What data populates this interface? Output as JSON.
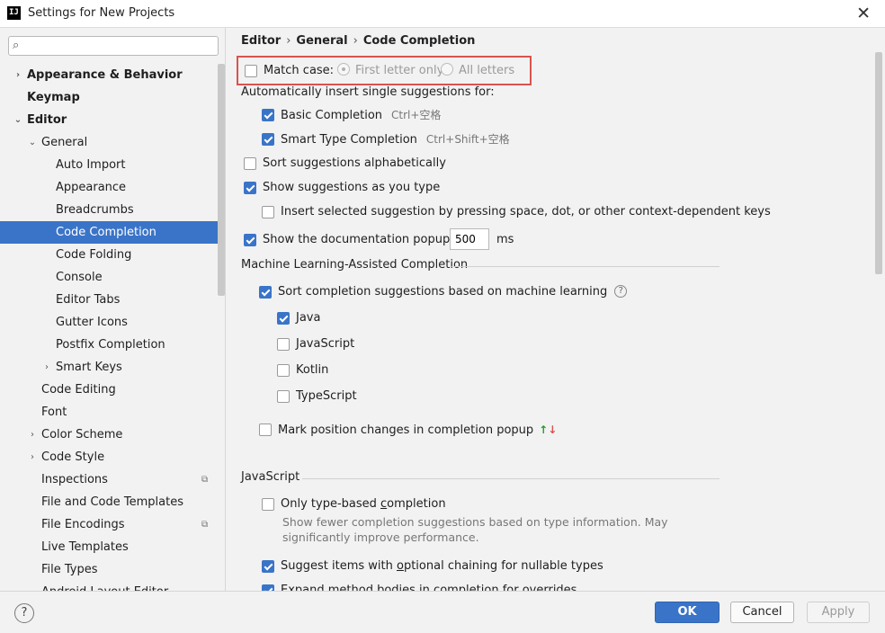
{
  "window": {
    "title": "Settings for New Projects",
    "app_icon_text": "IJ",
    "close_glyph": "✕"
  },
  "search": {
    "placeholder": "",
    "icon_glyph": "⌕"
  },
  "tree": [
    {
      "label": "Appearance & Behavior",
      "chevron": "›",
      "bold": true
    },
    {
      "label": "Keymap",
      "bold": true
    },
    {
      "label": "Editor",
      "chevron": "⌄",
      "bold": true
    },
    {
      "label": "General",
      "chevron": "⌄"
    },
    {
      "label": "Auto Import"
    },
    {
      "label": "Appearance"
    },
    {
      "label": "Breadcrumbs"
    },
    {
      "label": "Code Completion",
      "selected": true
    },
    {
      "label": "Code Folding"
    },
    {
      "label": "Console"
    },
    {
      "label": "Editor Tabs"
    },
    {
      "label": "Gutter Icons"
    },
    {
      "label": "Postfix Completion"
    },
    {
      "label": "Smart Keys",
      "chevron": "›"
    },
    {
      "label": "Code Editing"
    },
    {
      "label": "Font"
    },
    {
      "label": "Color Scheme",
      "chevron": "›"
    },
    {
      "label": "Code Style",
      "chevron": "›"
    },
    {
      "label": "Inspections",
      "badge": "⧉"
    },
    {
      "label": "File and Code Templates"
    },
    {
      "label": "File Encodings",
      "badge": "⧉"
    },
    {
      "label": "Live Templates"
    },
    {
      "label": "File Types"
    },
    {
      "label": "Android Layout Editor"
    }
  ],
  "breadcrumb": {
    "part1": "Editor",
    "part2": "General",
    "part3": "Code Completion",
    "separator": "›"
  },
  "match_case": {
    "label": "Match case:",
    "checked": false,
    "option1": "First letter only",
    "option2": "All letters"
  },
  "auto_insert": {
    "title": "Automatically insert single suggestions for:",
    "basic": {
      "label": "Basic Completion",
      "shortcut": "Ctrl+空格",
      "checked": true
    },
    "smart": {
      "label": "Smart Type Completion",
      "shortcut": "Ctrl+Shift+空格",
      "checked": true
    }
  },
  "sort_alpha": {
    "label": "Sort suggestions alphabetically",
    "checked": false
  },
  "show_as_type": {
    "label": "Show suggestions as you type",
    "checked": true
  },
  "insert_selected": {
    "label": "Insert selected suggestion by pressing space, dot, or other context-dependent keys",
    "checked": false
  },
  "doc_popup": {
    "label": "Show the documentation popup in",
    "value": "500",
    "unit": "ms",
    "checked": true
  },
  "ml": {
    "title": "Machine Learning-Assisted Completion",
    "sort": {
      "label": "Sort completion suggestions based on machine learning",
      "checked": true,
      "help_glyph": "?"
    },
    "java": {
      "label": "Java",
      "checked": true
    },
    "javascript": {
      "label": "JavaScript",
      "checked": false
    },
    "kotlin": {
      "label": "Kotlin",
      "checked": false
    },
    "typescript": {
      "label": "TypeScript",
      "checked": false
    },
    "mark_changes": {
      "label": "Mark position changes in completion popup",
      "checked": false,
      "up_glyph": "↑",
      "down_glyph": "↓"
    }
  },
  "js": {
    "title": "JavaScript",
    "type_based": {
      "label_pre": "Only type-based ",
      "label_u": "c",
      "label_post": "ompletion",
      "checked": false
    },
    "hint_line1": "Show fewer completion suggestions based on type information. May",
    "hint_line2": "significantly improve performance.",
    "optional_chaining": {
      "label_pre": "Suggest items with ",
      "label_u": "o",
      "label_post": "ptional chaining for nullable types",
      "checked": true
    },
    "expand_bodies": {
      "label": "Expand method bodies in completion for overrides",
      "checked": true
    }
  },
  "footer": {
    "help_glyph": "?",
    "ok": "OK",
    "cancel": "Cancel",
    "apply": "Apply"
  }
}
